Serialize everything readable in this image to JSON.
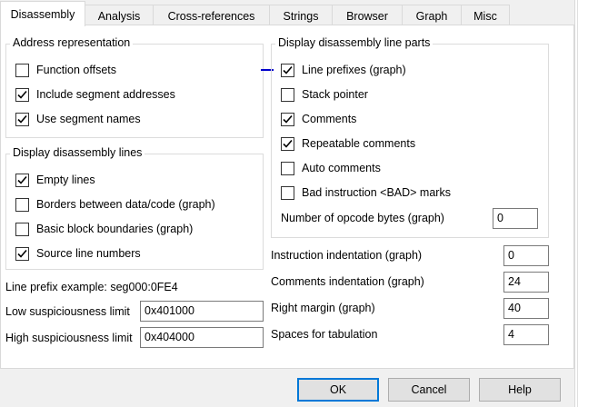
{
  "tabs": [
    {
      "label": "Disassembly",
      "active": true
    },
    {
      "label": "Analysis"
    },
    {
      "label": "Cross-references"
    },
    {
      "label": "Strings"
    },
    {
      "label": "Browser"
    },
    {
      "label": "Graph"
    },
    {
      "label": "Misc"
    }
  ],
  "address_repr": {
    "title": "Address representation",
    "items": [
      {
        "label": "Function offsets",
        "checked": false
      },
      {
        "label": "Include segment addresses",
        "checked": true
      },
      {
        "label": "Use segment names",
        "checked": true
      }
    ]
  },
  "disasm_lines": {
    "title": "Display disassembly lines",
    "items": [
      {
        "label": "Empty lines",
        "checked": true
      },
      {
        "label": "Borders between data/code (graph)",
        "checked": false
      },
      {
        "label": "Basic block boundaries (graph)",
        "checked": false
      },
      {
        "label": "Source line numbers",
        "checked": true
      }
    ]
  },
  "line_parts": {
    "title": "Display disassembly line parts",
    "items": [
      {
        "label": "Line prefixes (graph)",
        "checked": true
      },
      {
        "label": "Stack pointer",
        "checked": false
      },
      {
        "label": "Comments",
        "checked": true
      },
      {
        "label": "Repeatable comments",
        "checked": true
      },
      {
        "label": "Auto comments",
        "checked": false
      },
      {
        "label": "Bad instruction <BAD> marks",
        "checked": false
      }
    ],
    "opcode_label": "Number of opcode bytes (graph)",
    "opcode_value": "0"
  },
  "prefix_example": "Line prefix example: seg000:0FE4",
  "limits": {
    "low_label": "Low suspiciousness limit",
    "low_value": "0x401000",
    "high_label": "High suspiciousness limit",
    "high_value": "0x404000"
  },
  "indent": {
    "instr_label": "Instruction indentation (graph)",
    "instr_value": "0",
    "comments_label": "Comments indentation (graph)",
    "comments_value": "24",
    "margin_label": "Right margin (graph)",
    "margin_value": "40",
    "tab_label": "Spaces for tabulation",
    "tab_value": "4"
  },
  "buttons": {
    "ok": "OK",
    "cancel": "Cancel",
    "help": "Help"
  },
  "colors": {
    "accent": "#0078d7",
    "marker": "#0000cc"
  }
}
